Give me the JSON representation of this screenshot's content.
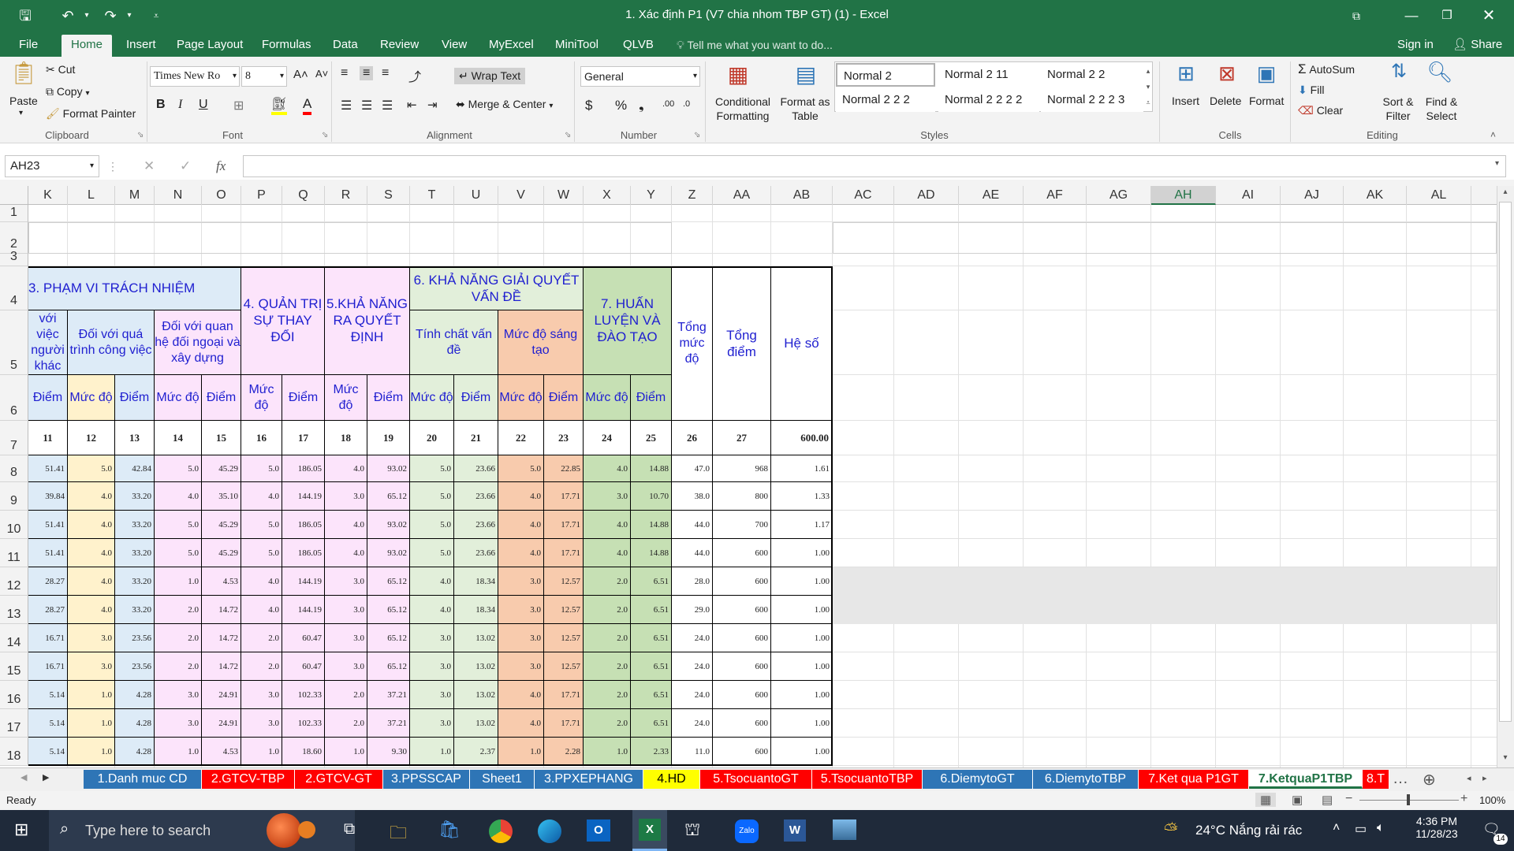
{
  "title": "1. Xác định P1  (V7 chia nhom TBP GT) (1) - Excel",
  "ribbon_tabs": [
    "File",
    "Home",
    "Insert",
    "Page Layout",
    "Formulas",
    "Data",
    "Review",
    "View",
    "MyExcel",
    "MiniTool",
    "QLVB"
  ],
  "tell_me": "Tell me what you want to do...",
  "signin": "Sign in",
  "share": "Share",
  "clipboard": {
    "paste": "Paste",
    "cut": "Cut",
    "copy": "Copy",
    "format_painter": "Format Painter",
    "label": "Clipboard"
  },
  "font": {
    "name": "Times New Ro",
    "size": "8",
    "label": "Font"
  },
  "alignment": {
    "wrap": "Wrap Text",
    "merge": "Merge & Center",
    "label": "Alignment"
  },
  "number": {
    "format": "General",
    "label": "Number"
  },
  "styles": {
    "cond": "Conditional Formatting",
    "fmt_table": "Format as Table",
    "items": [
      "Normal 2",
      "Normal 2 11",
      "Normal 2 2",
      "Normal 2 2 2",
      "Normal 2 2 2 2",
      "Normal 2 2 2 3"
    ],
    "label": "Styles"
  },
  "cells": {
    "insert": "Insert",
    "delete": "Delete",
    "format": "Format",
    "label": "Cells"
  },
  "editing": {
    "autosum": "AutoSum",
    "fill": "Fill",
    "clear": "Clear",
    "sort": "Sort & Filter",
    "find": "Find & Select",
    "label": "Editing"
  },
  "namebox": "AH23",
  "columns": [
    "K",
    "L",
    "M",
    "N",
    "O",
    "P",
    "Q",
    "R",
    "S",
    "T",
    "U",
    "V",
    "W",
    "X",
    "Y",
    "Z",
    "AA",
    "AB",
    "AC",
    "AD",
    "AE",
    "AF",
    "AG",
    "AH",
    "AI",
    "AJ",
    "AK",
    "AL"
  ],
  "rownums": [
    "1",
    "2",
    "3",
    "4",
    "5",
    "6",
    "7",
    "8",
    "9",
    "10",
    "11",
    "12",
    "13",
    "14",
    "15",
    "16",
    "17",
    "18"
  ],
  "headers": {
    "g3": "3. PHẠM VI TRÁCH NHIỆM",
    "k5": "với việc người khác",
    "l5": "Đối với quá trình công việc",
    "n5": "Đối với quan hệ đối ngoại và xây dựng",
    "g4": "4. QUẢN TRỊ SỰ THAY ĐỔI",
    "g5": "5.KHẢ NĂNG RA QUYẾT ĐỊNH",
    "g6": "6. KHẢ NĂNG GIẢI QUYẾT VẤN ĐỀ",
    "t5": "Tính chất vấn đề",
    "v5": "Mức độ sáng tạo",
    "g7": "7. HUẤN LUYỆN VÀ ĐÀO TẠO",
    "z": "Tổng mức độ",
    "aa": "Tổng điểm",
    "ab": "Hệ số",
    "row6": [
      "Điểm",
      "Mức độ",
      "Điểm",
      "Mức độ",
      "Điểm",
      "Mức độ",
      "Điểm",
      "Mức độ",
      "Điểm",
      "Mức độ",
      "Điểm",
      "Mức độ",
      "Điểm",
      "Mức độ",
      "Điểm"
    ],
    "row7": [
      "11",
      "12",
      "13",
      "14",
      "15",
      "16",
      "17",
      "18",
      "19",
      "20",
      "21",
      "22",
      "23",
      "24",
      "25",
      "26",
      "27",
      "600.00"
    ]
  },
  "rows": [
    [
      "51.41",
      "5.0",
      "42.84",
      "5.0",
      "45.29",
      "5.0",
      "186.05",
      "4.0",
      "93.02",
      "5.0",
      "23.66",
      "5.0",
      "22.85",
      "4.0",
      "14.88",
      "47.0",
      "968",
      "1.61"
    ],
    [
      "39.84",
      "4.0",
      "33.20",
      "4.0",
      "35.10",
      "4.0",
      "144.19",
      "3.0",
      "65.12",
      "5.0",
      "23.66",
      "4.0",
      "17.71",
      "3.0",
      "10.70",
      "38.0",
      "800",
      "1.33"
    ],
    [
      "51.41",
      "4.0",
      "33.20",
      "5.0",
      "45.29",
      "5.0",
      "186.05",
      "4.0",
      "93.02",
      "5.0",
      "23.66",
      "4.0",
      "17.71",
      "4.0",
      "14.88",
      "44.0",
      "700",
      "1.17"
    ],
    [
      "51.41",
      "4.0",
      "33.20",
      "5.0",
      "45.29",
      "5.0",
      "186.05",
      "4.0",
      "93.02",
      "5.0",
      "23.66",
      "4.0",
      "17.71",
      "4.0",
      "14.88",
      "44.0",
      "600",
      "1.00"
    ],
    [
      "28.27",
      "4.0",
      "33.20",
      "1.0",
      "4.53",
      "4.0",
      "144.19",
      "3.0",
      "65.12",
      "4.0",
      "18.34",
      "3.0",
      "12.57",
      "2.0",
      "6.51",
      "28.0",
      "600",
      "1.00"
    ],
    [
      "28.27",
      "4.0",
      "33.20",
      "2.0",
      "14.72",
      "4.0",
      "144.19",
      "3.0",
      "65.12",
      "4.0",
      "18.34",
      "3.0",
      "12.57",
      "2.0",
      "6.51",
      "29.0",
      "600",
      "1.00"
    ],
    [
      "16.71",
      "3.0",
      "23.56",
      "2.0",
      "14.72",
      "2.0",
      "60.47",
      "3.0",
      "65.12",
      "3.0",
      "13.02",
      "3.0",
      "12.57",
      "2.0",
      "6.51",
      "24.0",
      "600",
      "1.00"
    ],
    [
      "16.71",
      "3.0",
      "23.56",
      "2.0",
      "14.72",
      "2.0",
      "60.47",
      "3.0",
      "65.12",
      "3.0",
      "13.02",
      "3.0",
      "12.57",
      "2.0",
      "6.51",
      "24.0",
      "600",
      "1.00"
    ],
    [
      "5.14",
      "1.0",
      "4.28",
      "3.0",
      "24.91",
      "3.0",
      "102.33",
      "2.0",
      "37.21",
      "3.0",
      "13.02",
      "4.0",
      "17.71",
      "2.0",
      "6.51",
      "24.0",
      "600",
      "1.00"
    ],
    [
      "5.14",
      "1.0",
      "4.28",
      "3.0",
      "24.91",
      "3.0",
      "102.33",
      "2.0",
      "37.21",
      "3.0",
      "13.02",
      "4.0",
      "17.71",
      "2.0",
      "6.51",
      "24.0",
      "600",
      "1.00"
    ],
    [
      "5.14",
      "1.0",
      "4.28",
      "1.0",
      "4.53",
      "1.0",
      "18.60",
      "1.0",
      "9.30",
      "1.0",
      "2.37",
      "1.0",
      "2.28",
      "1.0",
      "2.33",
      "11.0",
      "600",
      "1.00"
    ]
  ],
  "sheet_tabs": [
    {
      "name": "1.Danh muc CD",
      "color": "#2e75b6"
    },
    {
      "name": "2.GTCV-TBP",
      "color": "#ff0000"
    },
    {
      "name": "2.GTCV-GT",
      "color": "#ff0000"
    },
    {
      "name": "3.PPSSCAP",
      "color": "#2e75b6"
    },
    {
      "name": "Sheet1",
      "color": "#2e75b6"
    },
    {
      "name": "3.PPXEPHANG",
      "color": "#2e75b6"
    },
    {
      "name": "4.HD",
      "color": "#ffff00"
    },
    {
      "name": "5.TsocuantoGT",
      "color": "#ff0000"
    },
    {
      "name": "5.TsocuantoTBP",
      "color": "#ff0000"
    },
    {
      "name": "6.DiemytoGT",
      "color": "#2e75b6"
    },
    {
      "name": "6.DiemytoTBP",
      "color": "#2e75b6"
    },
    {
      "name": "7.Ket qua P1GT",
      "color": "#ff0000"
    },
    {
      "name": "7.KetquaP1TBP",
      "color": "#ffffff"
    },
    {
      "name": "8.T",
      "color": "#ff0000"
    }
  ],
  "status": {
    "ready": "Ready",
    "zoom": "100%"
  },
  "taskbar": {
    "search": "Type here to search",
    "weather": "24°C  Nắng rải rác",
    "time": "4:36 PM",
    "date": "11/28/23",
    "badge": "14"
  }
}
